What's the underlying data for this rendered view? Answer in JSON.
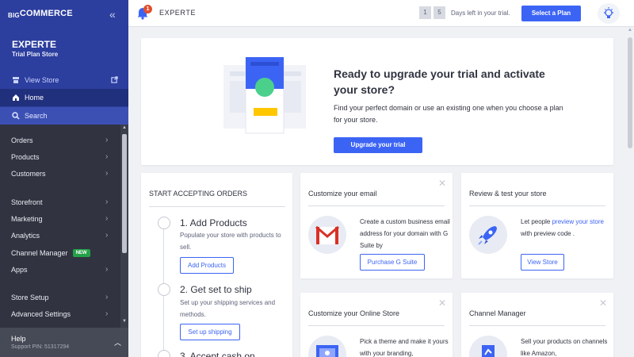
{
  "sidebar": {
    "logo_pre": "BIG",
    "logo_main": "COMMERCE",
    "collapse_icon": "«",
    "store_name": "EXPERTE",
    "store_plan": "Trial Plan Store",
    "view_store": "View Store",
    "home": "Home",
    "search": "Search",
    "nav": [
      {
        "label": "Orders"
      },
      {
        "label": "Products"
      },
      {
        "label": "Customers"
      },
      {
        "label": "Storefront"
      },
      {
        "label": "Marketing"
      },
      {
        "label": "Analytics"
      },
      {
        "label": "Channel Manager",
        "badge": "NEW"
      },
      {
        "label": "Apps"
      },
      {
        "label": "Store Setup"
      },
      {
        "label": "Advanced Settings"
      }
    ],
    "help_title": "Help",
    "help_pin": "Support PIN: 51317294"
  },
  "header": {
    "notification_count": "1",
    "store_name": "EXPERTE",
    "days": [
      "1",
      "5"
    ],
    "days_text": "Days left in your trial.",
    "select_plan": "Select a Plan"
  },
  "banner": {
    "title": "Ready to upgrade your trial and activate your store?",
    "text": "Find your perfect domain or use an existing one when you choose a plan for your store.",
    "button": "Upgrade your trial"
  },
  "orders_card": {
    "title": "START ACCEPTING ORDERS",
    "steps": [
      {
        "title": "1. Add Products",
        "desc": "Populate your store with products to sell.",
        "button": "Add Products"
      },
      {
        "title": "2. Get set to ship",
        "desc": "Set up your shipping services and methods.",
        "button": "Set up shipping"
      },
      {
        "title": "3. Accept cash on"
      }
    ]
  },
  "email_card": {
    "title": "Customize your email",
    "desc": "Create a custom business email address for your domain with G Suite by",
    "button": "Purchase G Suite"
  },
  "review_card": {
    "title": "Review & test your store",
    "desc_pre": "Let people ",
    "desc_link": "preview your store",
    "desc_post": " with preview code .",
    "button": "View Store"
  },
  "online_store_card": {
    "title": "Customize your Online Store",
    "desc": "Pick a theme and make it yours with your branding,"
  },
  "channel_card": {
    "title": "Channel Manager",
    "desc": "Sell your products on channels like Amazon,"
  },
  "colors": {
    "sidebar_dark": "#313440",
    "sidebar_brand": "#2c3e9e",
    "accent": "#3c64f4",
    "new_badge": "#24a148",
    "notification": "#e34e2f"
  }
}
